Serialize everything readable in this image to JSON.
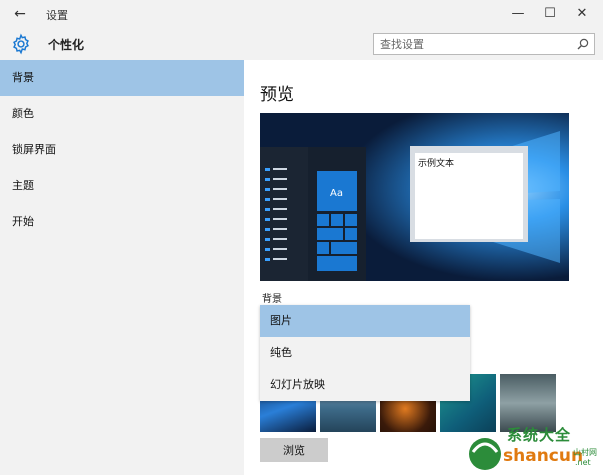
{
  "titlebar": {
    "back_glyph": "←",
    "title": "设置",
    "min_glyph": "—",
    "max_glyph": "☐",
    "close_glyph": "✕"
  },
  "header": {
    "title": "个性化",
    "icon": "gear-icon"
  },
  "search": {
    "placeholder": "查找设置",
    "icon": "search-icon"
  },
  "sidebar": {
    "items": [
      {
        "label": "背景",
        "active": true
      },
      {
        "label": "颜色",
        "active": false
      },
      {
        "label": "锁屏界面",
        "active": false
      },
      {
        "label": "主题",
        "active": false
      },
      {
        "label": "开始",
        "active": false
      }
    ]
  },
  "main": {
    "preview_title": "预览",
    "preview": {
      "tile_label": "Aa",
      "window_text": "示例文本"
    },
    "background_label": "背景",
    "dropdown": {
      "options": [
        "图片",
        "纯色",
        "幻灯片放映"
      ],
      "selected": "图片"
    },
    "browse_label": "浏览"
  },
  "watermark": {
    "text": "系统大全",
    "subtext": "shancun",
    "suffix": "山村网",
    "tld": ".net"
  },
  "colors": {
    "accent": "#9ec4e6",
    "chrome": "#f2f2f2",
    "tile_blue": "#1a78d2"
  }
}
